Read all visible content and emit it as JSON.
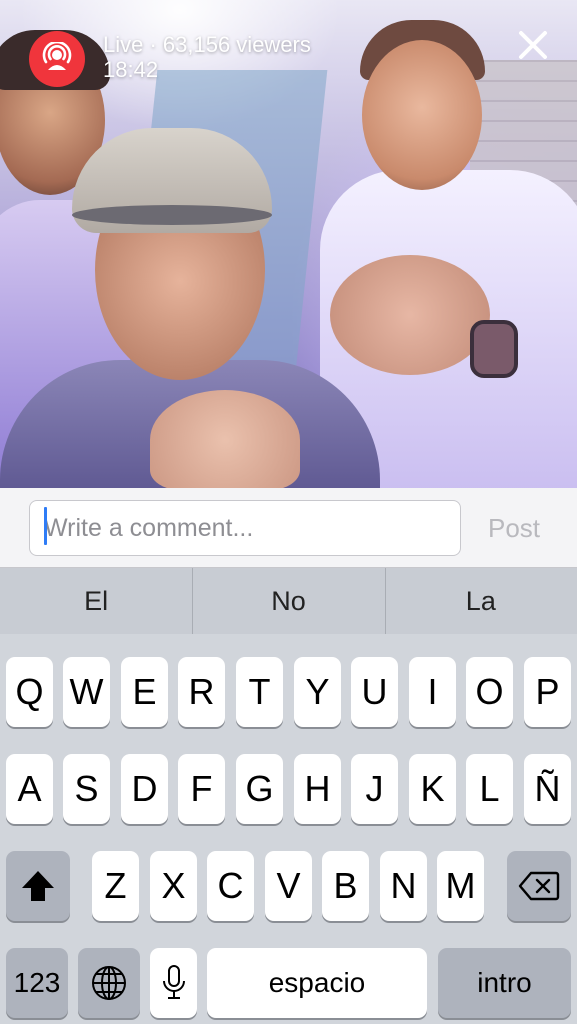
{
  "live": {
    "status": "Live · 63,156 viewers",
    "time": "18:42"
  },
  "comment": {
    "placeholder": "Write a comment...",
    "post_label": "Post"
  },
  "keyboard": {
    "suggestions": [
      "El",
      "No",
      "La"
    ],
    "row1": [
      "Q",
      "W",
      "E",
      "R",
      "T",
      "Y",
      "U",
      "I",
      "O",
      "P"
    ],
    "row2": [
      "A",
      "S",
      "D",
      "F",
      "G",
      "H",
      "J",
      "K",
      "L",
      "Ñ"
    ],
    "row3": [
      "Z",
      "X",
      "C",
      "V",
      "B",
      "N",
      "M"
    ],
    "numbers_label": "123",
    "space_label": "espacio",
    "return_label": "intro"
  },
  "colors": {
    "live_red": "#f0353c",
    "cursor_blue": "#2f7cf6"
  }
}
